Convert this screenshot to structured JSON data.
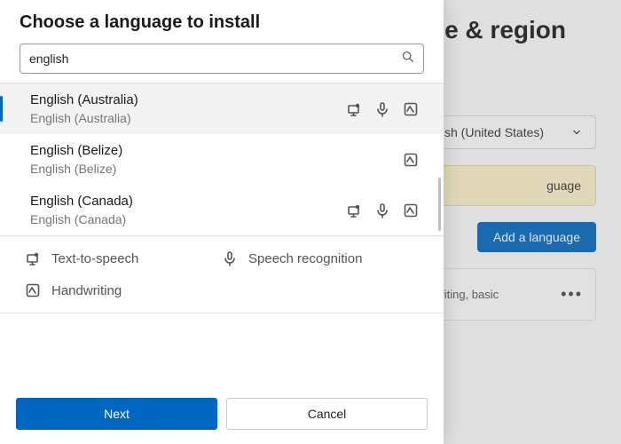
{
  "background": {
    "page_title": "e & region",
    "dropdown_value": "glish (United States)",
    "banner_text": "guage",
    "add_button": "Add a language",
    "card_text": "writing, basic"
  },
  "dialog": {
    "title": "Choose a language to install",
    "search_value": "english",
    "results": [
      {
        "name": "English (Australia)",
        "native": "English (Australia)",
        "tts": true,
        "speech": true,
        "hand": true,
        "selected": true
      },
      {
        "name": "English (Belize)",
        "native": "English (Belize)",
        "tts": false,
        "speech": false,
        "hand": true,
        "selected": false
      },
      {
        "name": "English (Canada)",
        "native": "English (Canada)",
        "tts": true,
        "speech": true,
        "hand": true,
        "selected": false
      }
    ],
    "legend": {
      "tts": "Text-to-speech",
      "speech": "Speech recognition",
      "hand": "Handwriting"
    },
    "buttons": {
      "next": "Next",
      "cancel": "Cancel"
    }
  }
}
